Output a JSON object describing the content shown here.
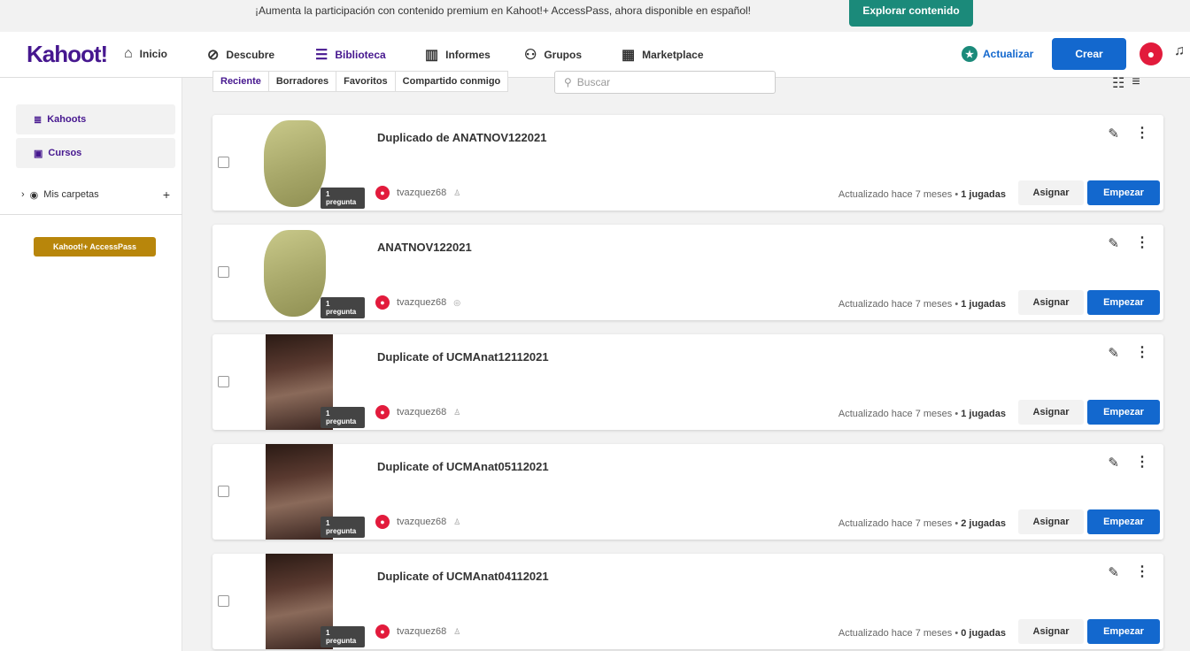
{
  "banner": {
    "text": "¡Aumenta la participación con contenido premium en Kahoot!+ AccessPass, ahora disponible en español!",
    "button": "Explorar contenido"
  },
  "nav": {
    "logo": "Kahoot!",
    "items": [
      {
        "label": "Inicio",
        "icon": "home-icon"
      },
      {
        "label": "Descubre",
        "icon": "compass-icon"
      },
      {
        "label": "Biblioteca",
        "icon": "list-icon",
        "active": true
      },
      {
        "label": "Informes",
        "icon": "chart-icon"
      },
      {
        "label": "Grupos",
        "icon": "people-icon"
      },
      {
        "label": "Marketplace",
        "icon": "store-icon"
      }
    ],
    "update_label": "Actualizar",
    "create_label": "Crear"
  },
  "sidebar": {
    "items": [
      {
        "label": "Kahoots",
        "icon": "kahoots-icon"
      },
      {
        "label": "Cursos",
        "icon": "courses-icon"
      }
    ],
    "folders_label": "Mis carpetas",
    "accesspass_label": "Kahoot!+ AccessPass"
  },
  "filters": {
    "tabs": [
      "Reciente",
      "Borradores",
      "Favoritos",
      "Compartido conmigo"
    ],
    "search_placeholder": "Buscar"
  },
  "colors": {
    "brand": "#46178f",
    "primary": "#1368ce",
    "avatar": "#e21b3c",
    "accesspass": "#b8860b"
  },
  "cards": [
    {
      "title": "Duplicado de ANATNOV122021",
      "questions": "1 pregunta",
      "author": "tvazquez68",
      "updated": "Actualizado hace 7 meses",
      "plays": "1 jugadas",
      "assign": "Asignar",
      "start": "Empezar",
      "thumb": "bone"
    },
    {
      "title": "ANATNOV122021",
      "questions": "1 pregunta",
      "author": "tvazquez68",
      "updated": "Actualizado hace 7 meses",
      "plays": "1 jugadas",
      "assign": "Asignar",
      "start": "Empezar",
      "thumb": "bone"
    },
    {
      "title": "Duplicate of UCMAnat12112021",
      "questions": "1 pregunta",
      "author": "tvazquez68",
      "updated": "Actualizado hace 7 meses",
      "plays": "1 jugadas",
      "assign": "Asignar",
      "start": "Empezar",
      "thumb": "dark"
    },
    {
      "title": "Duplicate of UCMAnat05112021",
      "questions": "1 pregunta",
      "author": "tvazquez68",
      "updated": "Actualizado hace 7 meses",
      "plays": "2 jugadas",
      "assign": "Asignar",
      "start": "Empezar",
      "thumb": "dark"
    },
    {
      "title": "Duplicate of UCMAnat04112021",
      "questions": "1 pregunta",
      "author": "tvazquez68",
      "updated": "Actualizado hace 7 meses",
      "plays": "0 jugadas",
      "assign": "Asignar",
      "start": "Empezar",
      "thumb": "dark"
    }
  ]
}
